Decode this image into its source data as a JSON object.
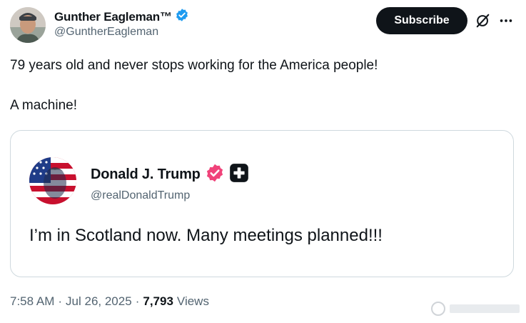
{
  "header": {
    "display_name": "Gunther Eagleman™",
    "handle": "@GuntherEagleman",
    "subscribe_label": "Subscribe",
    "verified_color": "#1d9bf0"
  },
  "tweet": {
    "text": "79 years old and never stops working for the America people!\n\nA machine!"
  },
  "quoted_post": {
    "display_name": "Donald J. Trump",
    "handle": "@realDonaldTrump",
    "text": "I’m in Scotland now. Many meetings planned!!!",
    "verified_color": "#f0437a"
  },
  "meta": {
    "time": "7:58 AM",
    "separator": "·",
    "date": "Jul 26, 2025",
    "views_count": "7,793",
    "views_label": "Views"
  },
  "icons": [
    "verified-badge-icon",
    "grok-icon",
    "more-icon",
    "truth-social-plus-icon"
  ]
}
